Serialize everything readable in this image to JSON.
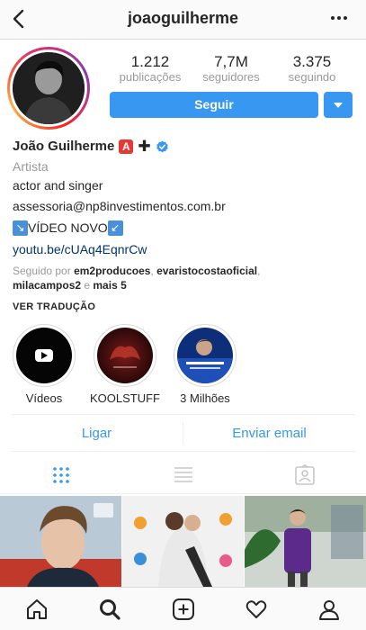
{
  "header": {
    "username": "joaoguilherme"
  },
  "stats": [
    {
      "value": "1.212",
      "label": "publicações"
    },
    {
      "value": "7,7M",
      "label": "seguidores"
    },
    {
      "value": "3.375",
      "label": "seguindo"
    }
  ],
  "follow_button": {
    "label": "Seguir"
  },
  "profile": {
    "name": "João Guilherme",
    "badge_a": "A",
    "badge_plus": "✚",
    "category": "Artista",
    "bio_line": "actor and singer",
    "email": "assessoria@np8investimentos.com.br",
    "video_arrow_left": "↘",
    "video_text": "VÍDEO NOVO",
    "video_arrow_right": "↙",
    "link": "youtu.be/cUAq4EqnrCw",
    "followed_prefix": "Seguido por ",
    "followed_1": "em2producoes",
    "followed_sep1": ", ",
    "followed_2": "evaristocostaoficial",
    "followed_sep2": ",",
    "followed_3": "milacampos2",
    "followed_and": " e ",
    "followed_more": "mais 5",
    "translate": "VER TRADUÇÃO"
  },
  "highlights": [
    {
      "label": "Vídeos",
      "icon": "youtube-icon"
    },
    {
      "label": "KOOLSTUFF"
    },
    {
      "label": "3 Milhões"
    }
  ],
  "actions": {
    "call": "Ligar",
    "email": "Enviar email"
  },
  "tabs": [
    "grid-icon",
    "list-icon",
    "tagged-icon"
  ],
  "bottom_nav": [
    "home-icon",
    "search-icon",
    "add-icon",
    "heart-icon",
    "profile-icon"
  ],
  "colors": {
    "accent": "#3897f0",
    "link": "#003569",
    "muted": "#999999",
    "text": "#262626"
  }
}
